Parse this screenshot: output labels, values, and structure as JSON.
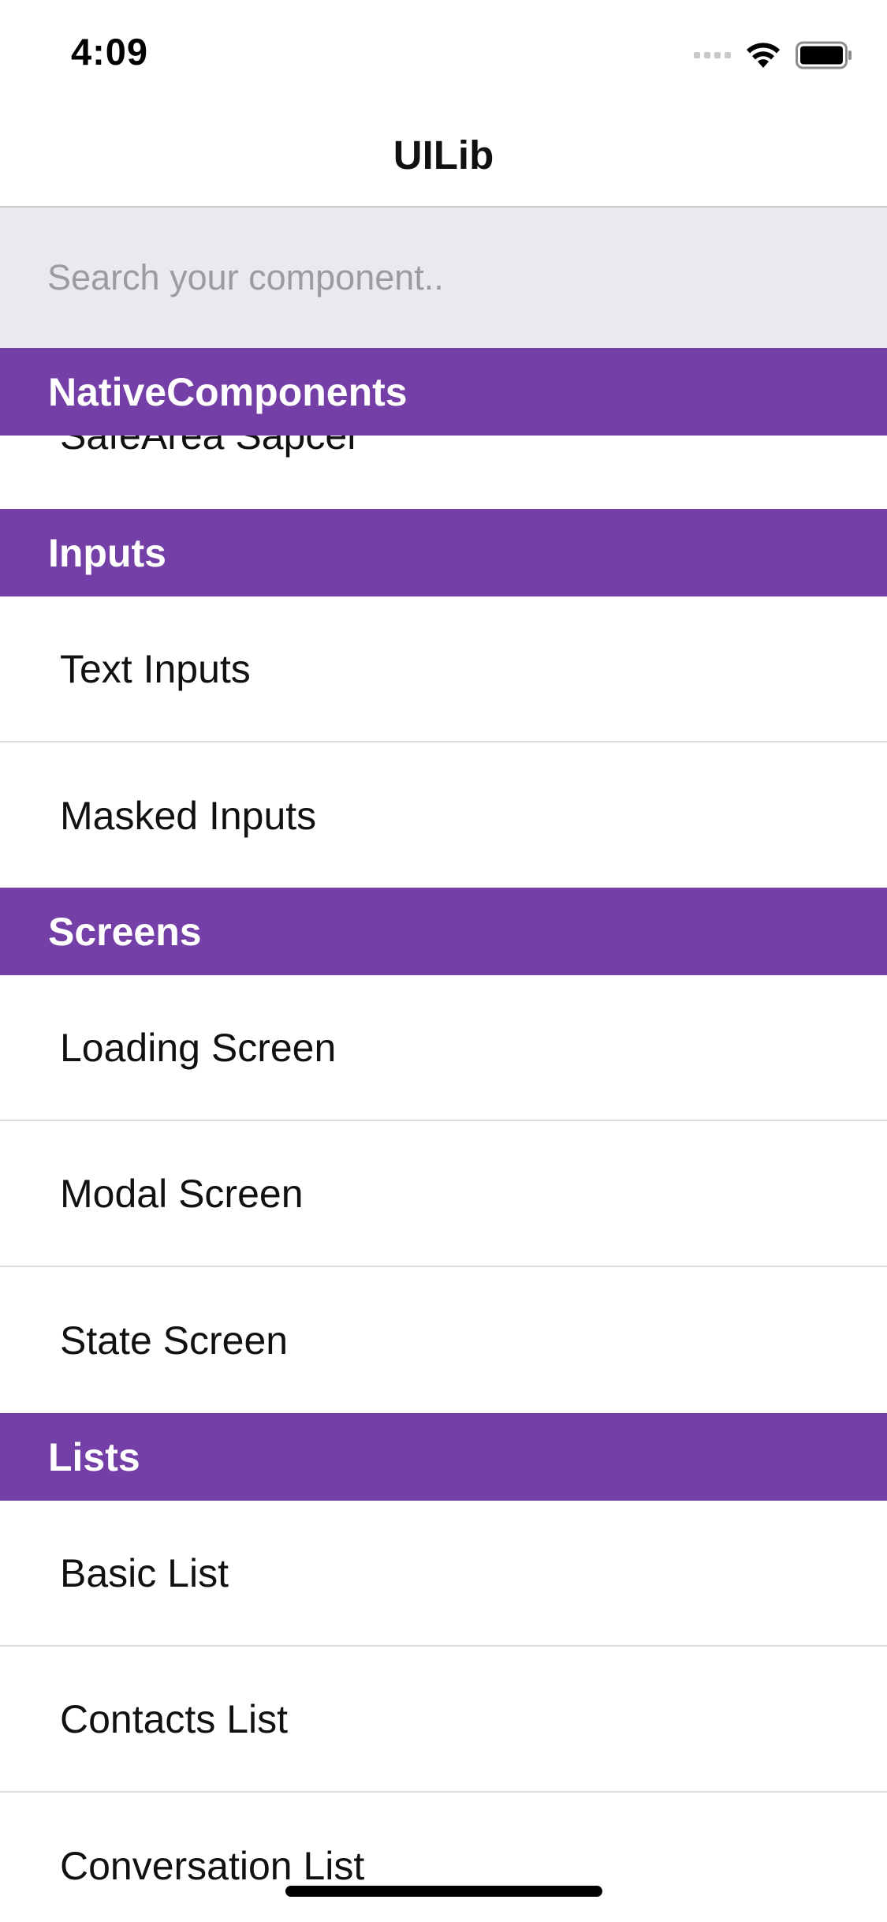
{
  "status_bar": {
    "time": "4:09",
    "icons": [
      "cellular-dots-icon",
      "wifi-icon",
      "battery-icon"
    ]
  },
  "nav": {
    "title": "UILib"
  },
  "search": {
    "placeholder": "Search your component..",
    "value": ""
  },
  "colors": {
    "section_header": "#743fa6",
    "search_bg": "#e9e9ef",
    "separator": "#dcdcdc"
  },
  "sections": [
    {
      "title": "NativeComponents",
      "items": [
        "SafeArea Sapcer"
      ]
    },
    {
      "title": "Inputs",
      "items": [
        "Text Inputs",
        "Masked Inputs"
      ]
    },
    {
      "title": "Screens",
      "items": [
        "Loading Screen",
        "Modal Screen",
        "State Screen"
      ]
    },
    {
      "title": "Lists",
      "items": [
        "Basic List",
        "Contacts List",
        "Conversation List"
      ]
    }
  ]
}
